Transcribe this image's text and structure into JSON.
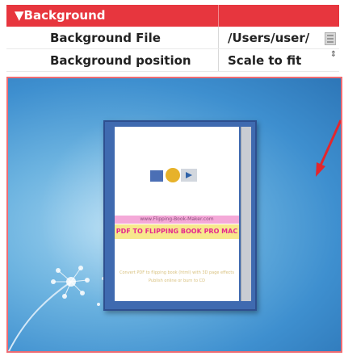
{
  "section": {
    "title": "▼Background"
  },
  "rows": [
    {
      "label": "Background File",
      "value": "/Users/user/"
    },
    {
      "label": "Background position",
      "value": "Scale to fit"
    }
  ],
  "stepper_symbol": "⇕",
  "icons": {
    "file": "file-icon",
    "arrow": "red-arrow-icon",
    "dandelion": "dandelion-icon"
  },
  "book": {
    "url": "www.Flipping-Book-Maker.com",
    "title": "PDF TO FLIPPING BOOK PRO MAC",
    "desc1": "Convert PDF to flipping book (html) with 3D page effects",
    "desc2": "Publish online or burn to CD"
  },
  "colors": {
    "header_red": "#e7363e",
    "frame_red": "#ef6c72",
    "sky_blue": "#3e8fcf",
    "book_blue": "#3f6ab0"
  }
}
